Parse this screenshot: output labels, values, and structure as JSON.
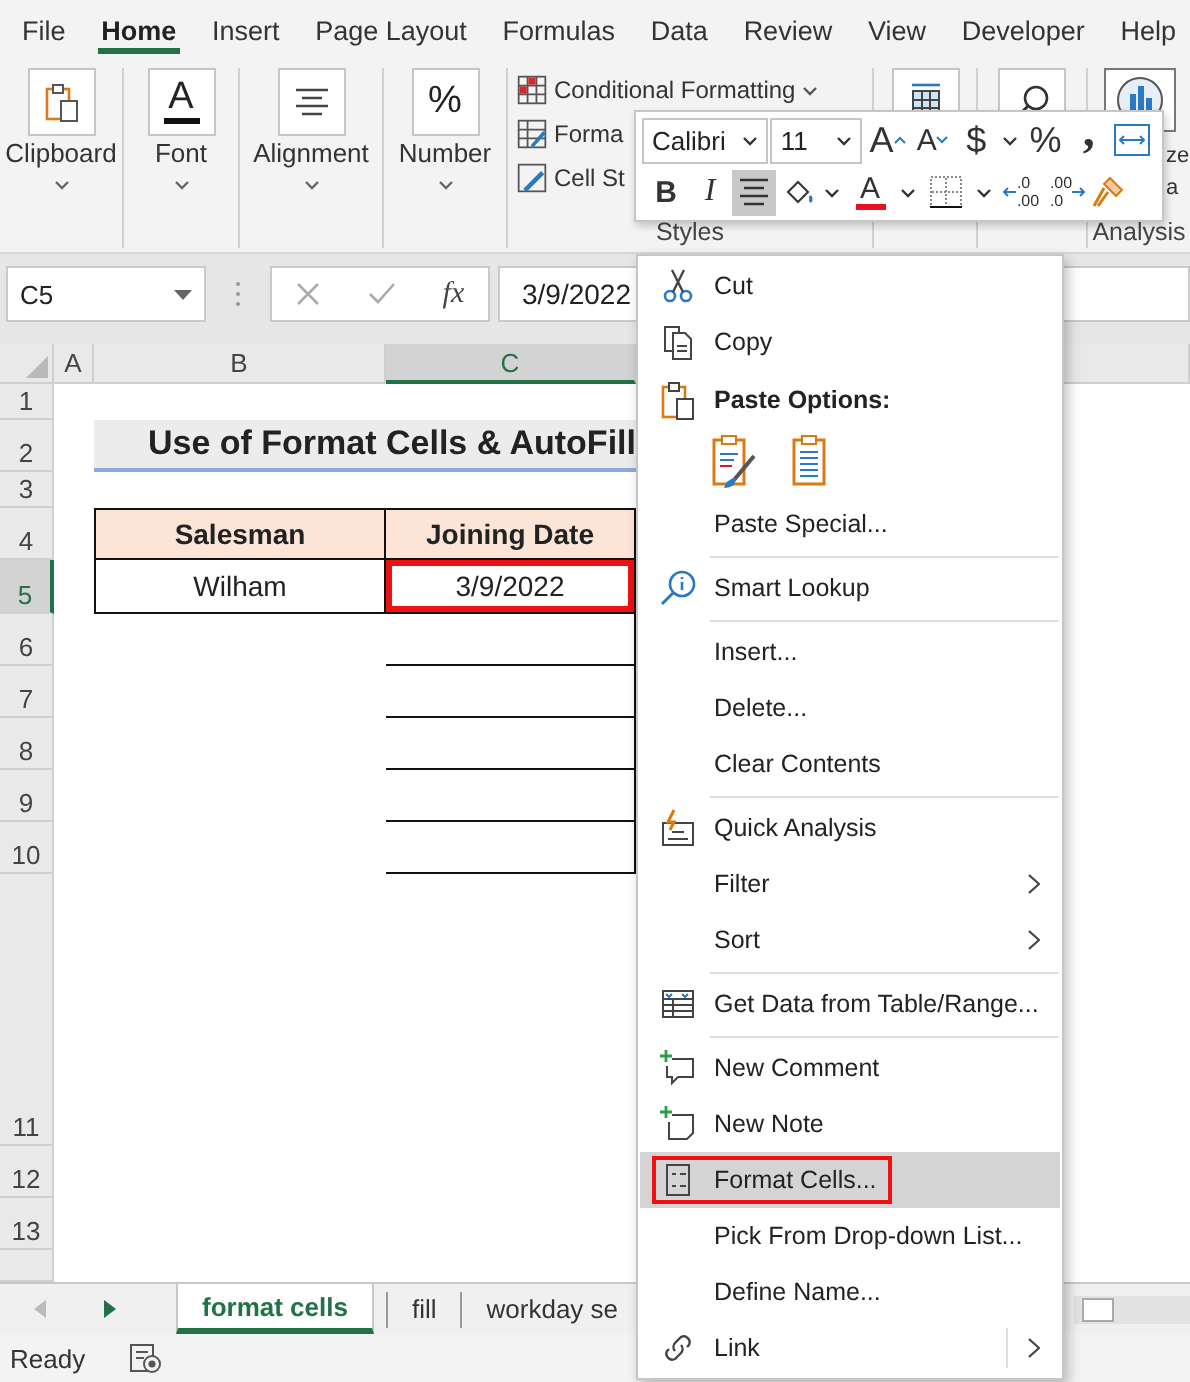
{
  "ribbon_tabs": [
    {
      "label": "File",
      "selected": false
    },
    {
      "label": "Home",
      "selected": true
    },
    {
      "label": "Insert",
      "selected": false
    },
    {
      "label": "Page Layout",
      "selected": false
    },
    {
      "label": "Formulas",
      "selected": false
    },
    {
      "label": "Data",
      "selected": false
    },
    {
      "label": "Review",
      "selected": false
    },
    {
      "label": "View",
      "selected": false
    },
    {
      "label": "Developer",
      "selected": false
    },
    {
      "label": "Help",
      "selected": false
    }
  ],
  "ribbon_groups": [
    {
      "kind": "clipboard",
      "label": "Clipboard"
    },
    {
      "kind": "font",
      "label": "Font",
      "symbol": "A"
    },
    {
      "kind": "alignment",
      "label": "Alignment"
    },
    {
      "kind": "number",
      "label": "Number",
      "symbol": "%"
    },
    {
      "kind": "styles",
      "label": "Styles",
      "commands": [
        "Conditional Formatting",
        "Forma",
        "Cell St"
      ]
    },
    {
      "kind": "cells"
    },
    {
      "kind": "editing"
    },
    {
      "kind": "analysis",
      "label": "Analysis",
      "texts": [
        "ze",
        "a"
      ]
    }
  ],
  "mini_toolbar": {
    "font": "Calibri",
    "size": "11",
    "row_1": [
      {
        "kind": "grow",
        "text": "A",
        "selected": false
      },
      {
        "kind": "shrink",
        "text": "A",
        "selected": false
      },
      {
        "kind": "currency",
        "text": "$",
        "selected": false
      },
      {
        "kind": "caret",
        "selected": false
      },
      {
        "kind": "percent",
        "text": "%",
        "selected": false
      },
      {
        "kind": "comma",
        "text": ",",
        "selected": false
      },
      {
        "kind": "wrap",
        "selected": false
      }
    ],
    "row_2": [
      {
        "kind": "bold",
        "text": "B",
        "selected": false
      },
      {
        "kind": "italic",
        "text": "I",
        "selected": false
      },
      {
        "kind": "align",
        "selected": true
      },
      {
        "kind": "fill",
        "selected": false
      },
      {
        "kind": "caret",
        "selected": false
      },
      {
        "kind": "fontcolor",
        "text": "A",
        "selected": false
      },
      {
        "kind": "caret",
        "selected": false
      },
      {
        "kind": "borders",
        "selected": false
      },
      {
        "kind": "caret",
        "selected": false
      },
      {
        "kind": "decdec",
        "text": ".0",
        "text_2": ".00",
        "selected": false
      },
      {
        "kind": "incdec",
        "text": ".00",
        "text_2": ".0",
        "selected": false
      },
      {
        "kind": "painter",
        "selected": false
      }
    ]
  },
  "formula_bar": {
    "name_box": "C5",
    "function_label": "fx",
    "value": "3/9/2022"
  },
  "sheet": {
    "columns": [
      {
        "label": "A",
        "selected": false
      },
      {
        "label": "B",
        "selected": false
      },
      {
        "label": "C",
        "selected": true
      }
    ],
    "rows": [
      {
        "label": "1",
        "selected": false
      },
      {
        "label": "2",
        "selected": false
      },
      {
        "label": "3",
        "selected": false
      },
      {
        "label": "4",
        "selected": false
      },
      {
        "label": "5",
        "selected": true
      },
      {
        "label": "6",
        "selected": false
      },
      {
        "label": "7",
        "selected": false
      },
      {
        "label": "8",
        "selected": false
      },
      {
        "label": "9",
        "selected": false
      },
      {
        "label": "10",
        "selected": false
      },
      {
        "label": "11",
        "selected": false
      },
      {
        "label": "12",
        "selected": false
      },
      {
        "label": "13",
        "selected": false
      }
    ],
    "title": "Use of Format Cells & AutoFill",
    "table": {
      "columns": [
        "Salesman",
        "Joining Date"
      ],
      "rows": [
        {
          "cells": [
            {
              "text": "Wilham",
              "marked": false
            },
            {
              "text": "3/9/2022",
              "marked": true
            }
          ]
        }
      ]
    }
  },
  "context_menu": [
    {
      "kind": "command",
      "label": "Cut",
      "submenu": false,
      "split": false,
      "selected": false,
      "marked": false
    },
    {
      "kind": "command",
      "label": "Copy",
      "submenu": false,
      "split": false,
      "selected": false,
      "marked": false
    },
    {
      "kind": "heading",
      "label": "Paste Options:"
    },
    {
      "kind": "paste_buttons"
    },
    {
      "kind": "command",
      "label": "Paste Special...",
      "submenu": false,
      "split": false,
      "selected": false,
      "marked": false
    },
    {
      "kind": "separator"
    },
    {
      "kind": "command",
      "label": "Smart Lookup",
      "submenu": false,
      "split": false,
      "selected": false,
      "marked": false
    },
    {
      "kind": "separator"
    },
    {
      "kind": "command",
      "label": "Insert...",
      "submenu": false,
      "split": false,
      "selected": false,
      "marked": false
    },
    {
      "kind": "command",
      "label": "Delete...",
      "submenu": false,
      "split": false,
      "selected": false,
      "marked": false
    },
    {
      "kind": "command",
      "label": "Clear Contents",
      "submenu": false,
      "split": false,
      "selected": false,
      "marked": false
    },
    {
      "kind": "separator"
    },
    {
      "kind": "command",
      "label": "Quick Analysis",
      "submenu": false,
      "split": false,
      "selected": false,
      "marked": false
    },
    {
      "kind": "command",
      "label": "Filter",
      "submenu": true,
      "split": false,
      "selected": false,
      "marked": false
    },
    {
      "kind": "command",
      "label": "Sort",
      "submenu": true,
      "split": false,
      "selected": false,
      "marked": false
    },
    {
      "kind": "separator"
    },
    {
      "kind": "command",
      "label": "Get Data from Table/Range...",
      "submenu": false,
      "split": false,
      "selected": false,
      "marked": false
    },
    {
      "kind": "separator"
    },
    {
      "kind": "command",
      "label": "New Comment",
      "submenu": false,
      "split": false,
      "selected": false,
      "marked": false
    },
    {
      "kind": "command",
      "label": "New Note",
      "submenu": false,
      "split": false,
      "selected": false,
      "marked": false
    },
    {
      "kind": "command",
      "label": "Format Cells...",
      "submenu": false,
      "split": false,
      "selected": true,
      "marked": true
    },
    {
      "kind": "command",
      "label": "Pick From Drop-down List...",
      "submenu": false,
      "split": false,
      "selected": false,
      "marked": false
    },
    {
      "kind": "command",
      "label": "Define Name...",
      "submenu": false,
      "split": false,
      "selected": false,
      "marked": false
    },
    {
      "kind": "command",
      "label": "Link",
      "submenu": true,
      "split": true,
      "selected": false,
      "marked": false
    }
  ],
  "sheet_tabs": [
    {
      "label": "format cells",
      "selected": true
    },
    {
      "label": "fill",
      "selected": false
    },
    {
      "label": "workday se",
      "selected": false
    }
  ],
  "status_bar": {
    "text": "Ready"
  }
}
